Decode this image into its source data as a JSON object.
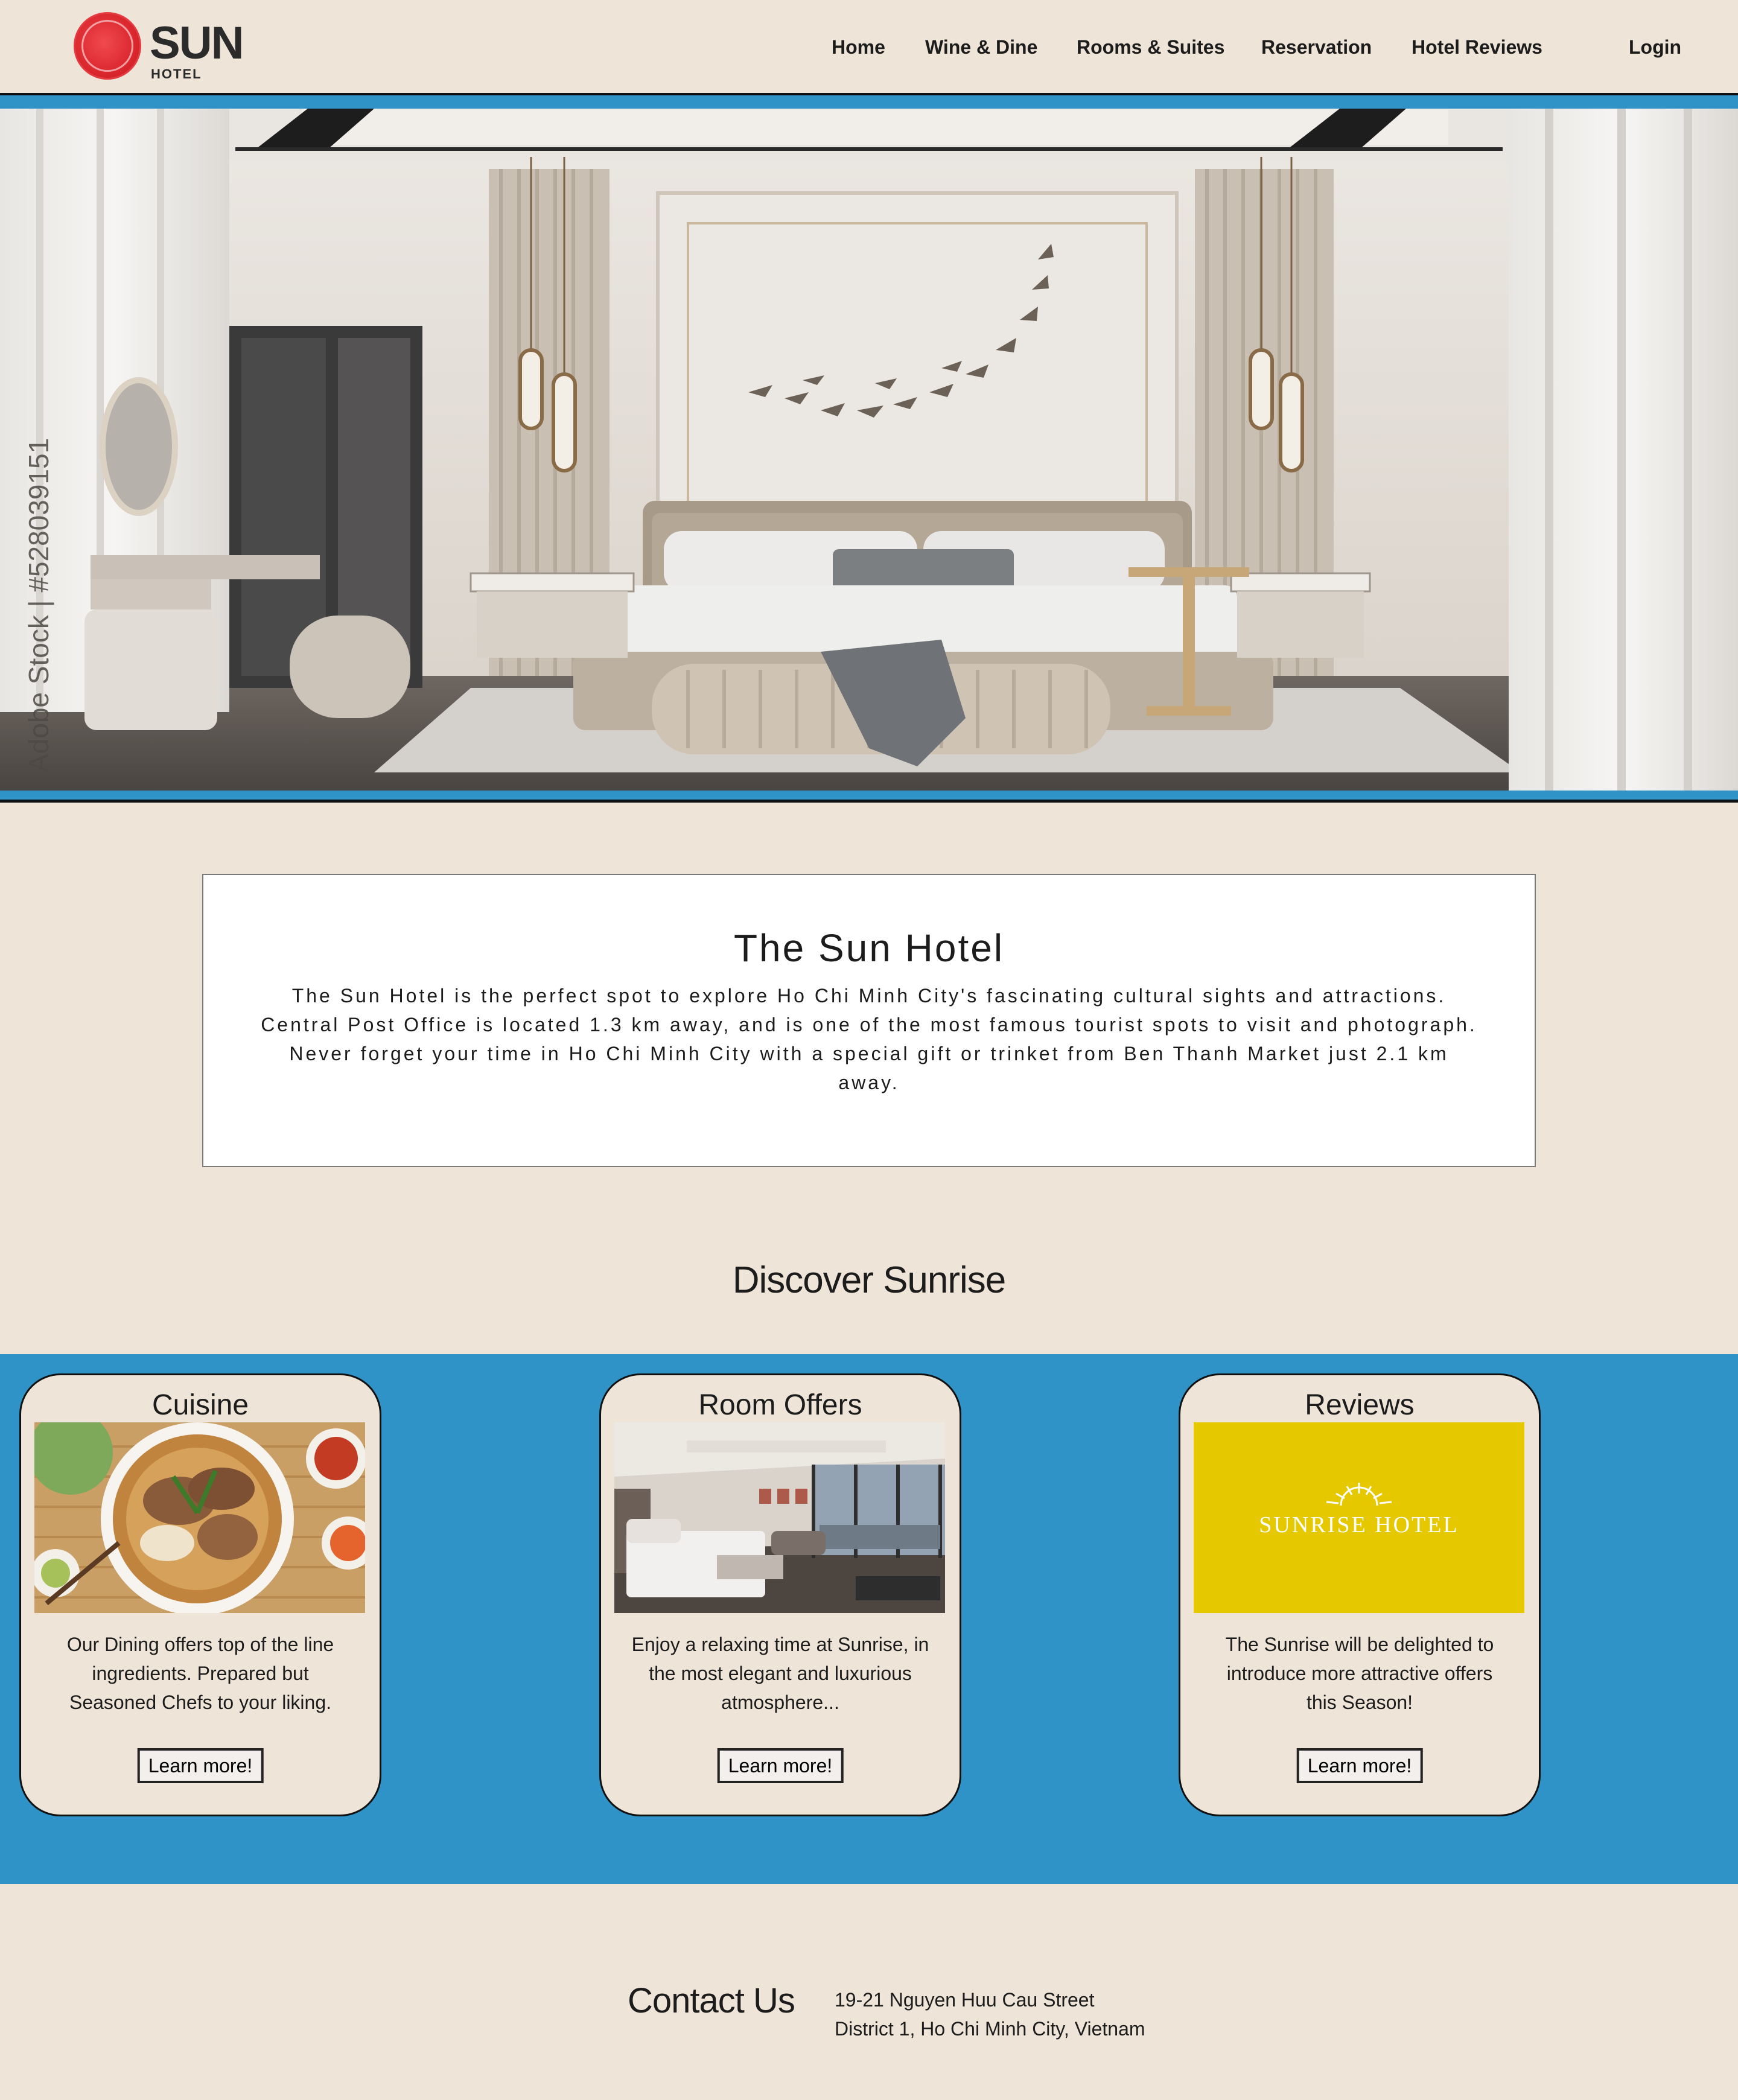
{
  "brand": {
    "name": "SUN",
    "tagline": "HOTEL"
  },
  "nav": {
    "items": [
      "Home",
      "Wine & Dine",
      "Rooms & Suites",
      "Reservation",
      "Hotel Reviews"
    ],
    "login": "Login"
  },
  "hero": {
    "watermark": "Adobe Stock | #528039151",
    "image": "luxury-bedroom-photo"
  },
  "intro": {
    "title": "The Sun Hotel",
    "body": "The Sun Hotel is the perfect spot to explore Ho Chi Minh City's fascinating cultural sights and attractions. Central Post Office is located 1.3 km away, and is one of the most famous tourist spots to visit and photograph. Never forget your time in Ho Chi Minh City with a special gift or trinket from Ben Thanh Market just 2.1 km away."
  },
  "discover": {
    "title": "Discover Sunrise",
    "cards": [
      {
        "title": "Cuisine",
        "text": "Our Dining offers top of the line ingredients. Prepared but Seasoned Chefs to your liking.",
        "button": "Learn more!",
        "image": "pho-bowl-photo"
      },
      {
        "title": "Room Offers",
        "text": "Enjoy a relaxing time at Sunrise, in the most elegant and luxurious atmosphere...",
        "button": "Learn more!",
        "image": "hotel-room-photo"
      },
      {
        "title": "Reviews",
        "text": "The Sunrise will be delighted to introduce more attractive offers this Season!",
        "button": "Learn more!",
        "image": "sunrise-hotel-logo",
        "logo_text": "SUNRISE HOTEL"
      }
    ]
  },
  "contact": {
    "title": "Contact Us",
    "address_line1": "19-21 Nguyen Huu Cau Street",
    "address_line2": "District 1, Ho Chi Minh City, Vietnam"
  },
  "colors": {
    "background": "#eee5d8",
    "accent": "#2f93c8",
    "logo_red": "#d9252c",
    "sunrise_yellow": "#e5c800"
  }
}
